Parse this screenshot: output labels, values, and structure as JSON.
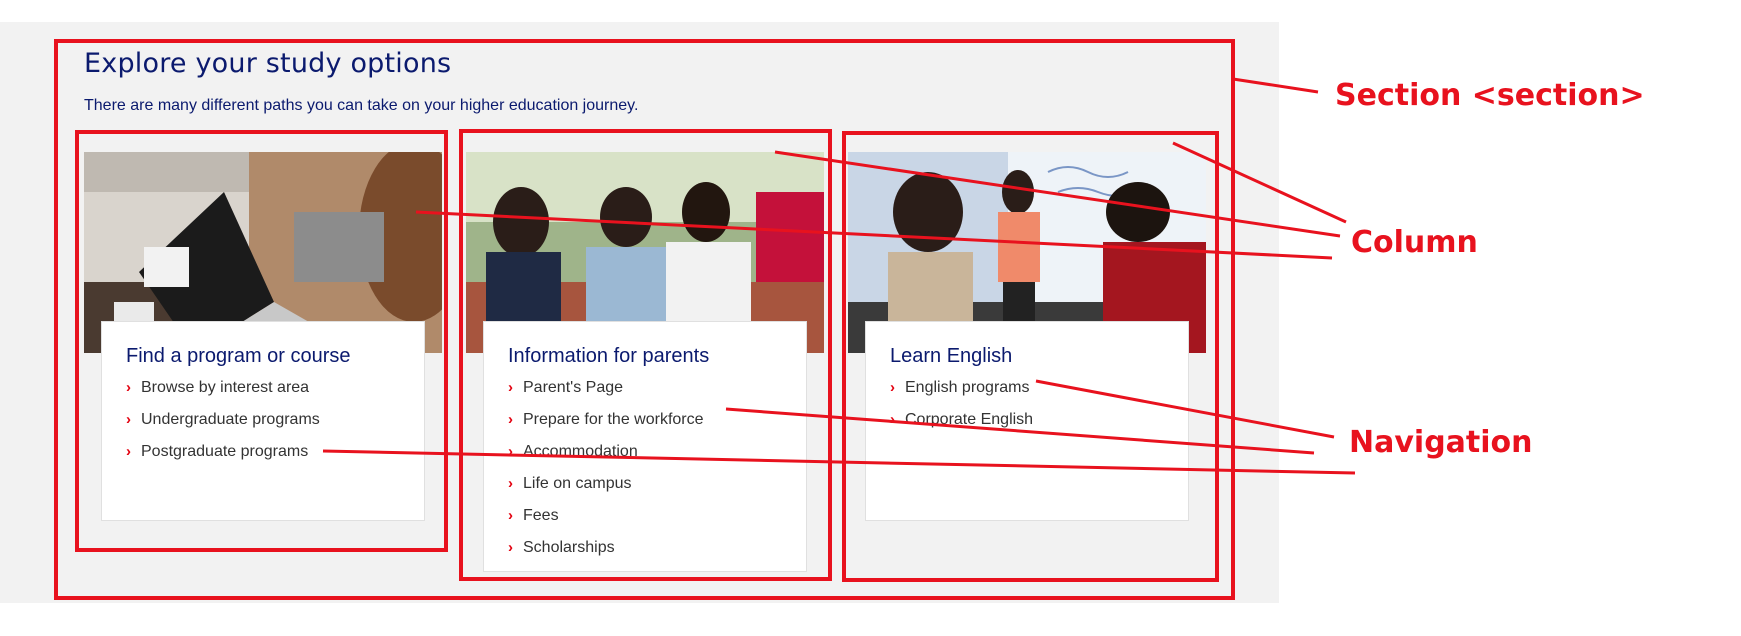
{
  "section": {
    "heading": "Explore your study options",
    "intro": "There are many different paths you can take on your higher education journey."
  },
  "columns": [
    {
      "title": "Find a program or course",
      "image_icon": "woman-laptop-photo",
      "links": [
        "Browse by interest area",
        "Undergraduate programs",
        "Postgraduate programs"
      ]
    },
    {
      "title": "Information for parents",
      "image_icon": "students-parent-photo",
      "links": [
        "Parent's Page",
        "Prepare for the workforce",
        "Accommodation",
        "Life on campus",
        "Fees",
        "Scholarships"
      ]
    },
    {
      "title": "Learn English",
      "image_icon": "classroom-whiteboard-photo",
      "links": [
        "English programs",
        "Corporate English"
      ]
    }
  ],
  "annotations": {
    "section_label": "Section <section>",
    "column_label": "Column",
    "navigation_label": "Navigation",
    "color": "#e8121e"
  },
  "colors": {
    "heading": "#0b1a6e",
    "chevron": "#e3000f",
    "section_bg": "#f2f2f2"
  },
  "chevron_glyph": "›"
}
